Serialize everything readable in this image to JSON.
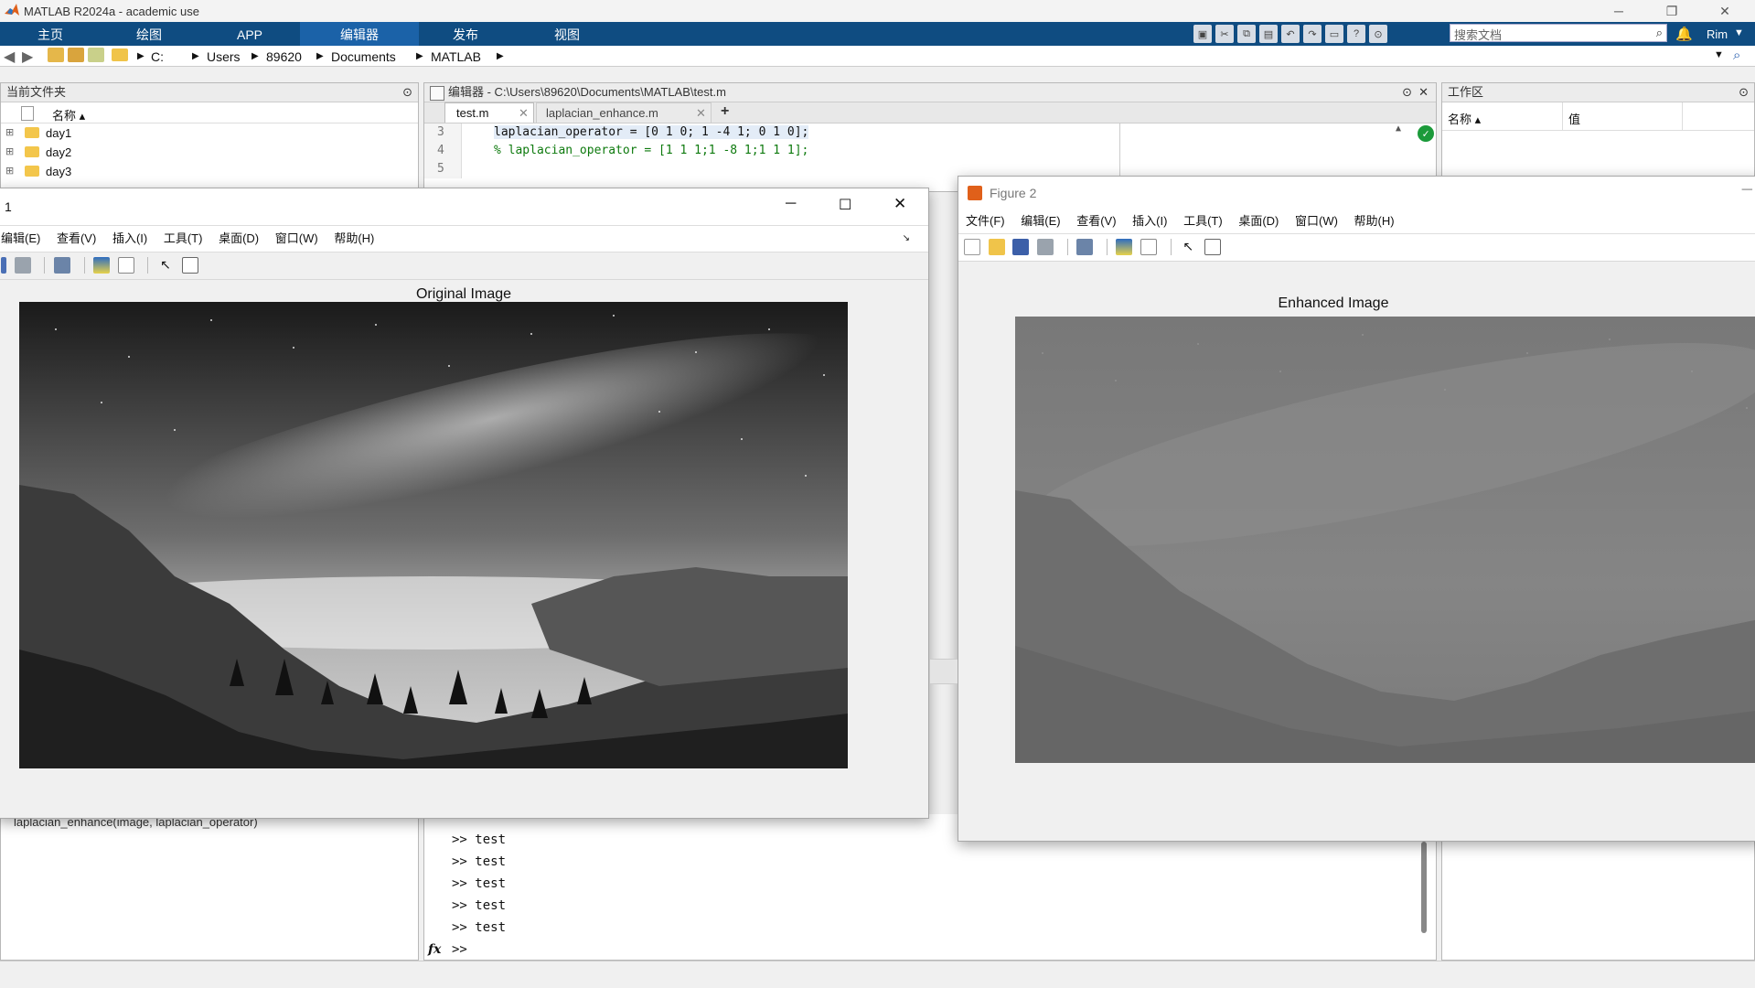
{
  "app": {
    "title": "MATLAB R2024a - academic use",
    "user": "Rim"
  },
  "window_controls": {
    "minimize": "─",
    "restore": "❐",
    "close": "✕"
  },
  "ribbon": {
    "tabs": [
      "主页",
      "绘图",
      "APP",
      "编辑器",
      "发布",
      "视图"
    ],
    "active_tab": "编辑器",
    "search_placeholder": "搜索文档"
  },
  "address": {
    "parts": [
      "C:",
      "Users",
      "89620",
      "Documents",
      "MATLAB"
    ]
  },
  "current_folder": {
    "title": "当前文件夹",
    "column": "名称 ▴",
    "items": [
      "day1",
      "day2",
      "day3"
    ],
    "bottom_item": "laplacian_enhance(image, laplacian_operator)"
  },
  "editor": {
    "title": "编辑器 - C:\\Users\\89620\\Documents\\MATLAB\\test.m",
    "tabs": [
      "test.m",
      "laplacian_enhance.m"
    ],
    "add_tab": "+",
    "lines": [
      {
        "num": "3",
        "text": "laplacian_operator = [0 1 0; 1 -4 1; 0 1 0];"
      },
      {
        "num": "4",
        "text": "% laplacian_operator = [1 1 1;1 -8 1;1 1 1];"
      },
      {
        "num": "5",
        "text": ""
      }
    ]
  },
  "workspace": {
    "title": "工作区",
    "col_name": "名称 ▴",
    "col_value": "值"
  },
  "command_window": {
    "history": [
      ">> test",
      ">> test",
      ">> test",
      ">> test",
      ">> test"
    ],
    "prompt": ">>",
    "fx": "fx"
  },
  "figure1": {
    "title": "1",
    "menus": [
      "编辑(E)",
      "查看(V)",
      "插入(I)",
      "工具(T)",
      "桌面(D)",
      "窗口(W)",
      "帮助(H)"
    ],
    "axes_title": "Original Image"
  },
  "figure2": {
    "title": "Figure 2",
    "menus": [
      "文件(F)",
      "编辑(E)",
      "查看(V)",
      "插入(I)",
      "工具(T)",
      "桌面(D)",
      "窗口(W)",
      "帮助(H)"
    ],
    "axes_title": "Enhanced Image"
  },
  "colors": {
    "ribbon": "#0f4c81",
    "ribbon_active": "#1b62a8",
    "comment": "#0e7a0e"
  }
}
